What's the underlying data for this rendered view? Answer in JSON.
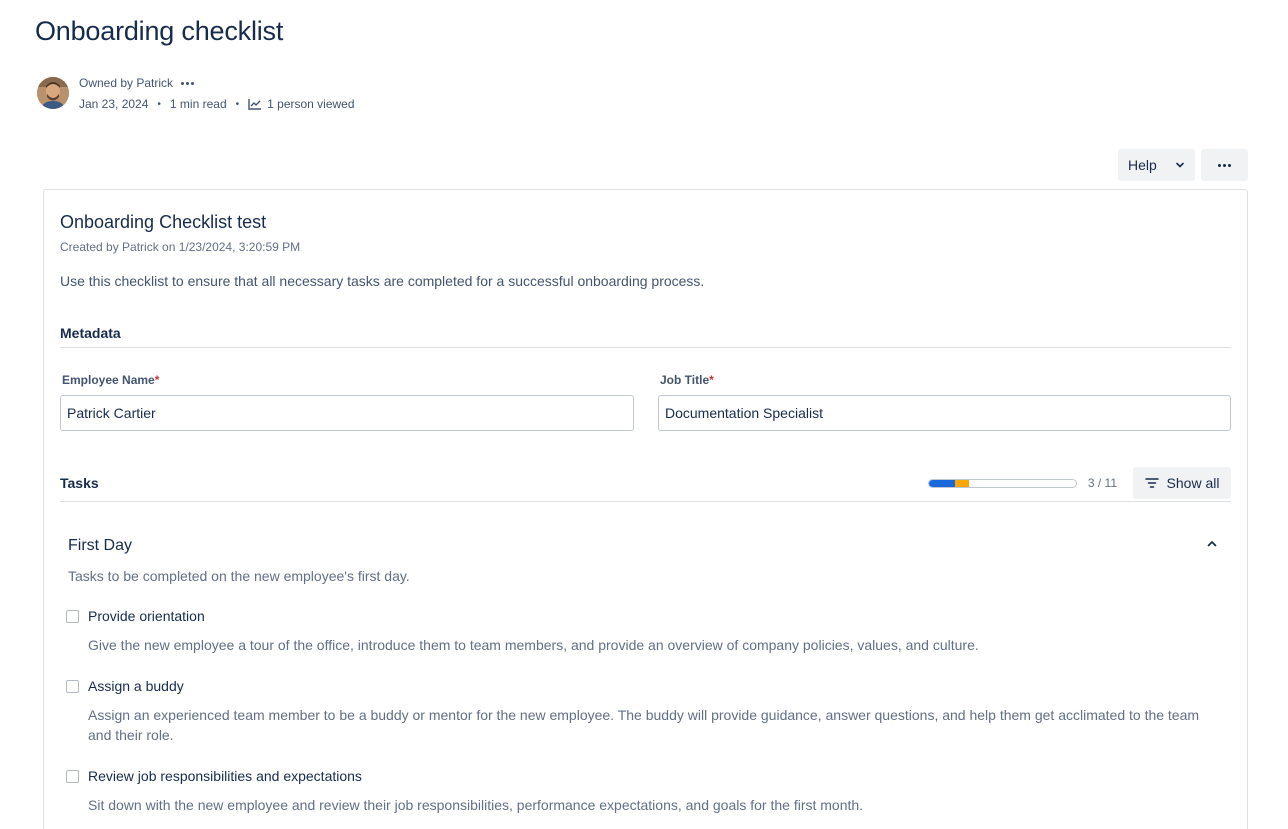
{
  "page": {
    "title": "Onboarding checklist"
  },
  "byline": {
    "owner": "Owned by Patrick",
    "date": "Jan 23, 2024",
    "read_time": "1 min read",
    "views": "1 person viewed"
  },
  "toolbar": {
    "help_label": "Help"
  },
  "checklist": {
    "title": "Onboarding Checklist test",
    "created": "Created by Patrick on 1/23/2024, 3:20:59 PM",
    "description": "Use this checklist to ensure that all necessary tasks are completed for a successful onboarding process."
  },
  "metadata": {
    "heading": "Metadata",
    "fields": [
      {
        "label": "Employee Name",
        "required_mark": "*",
        "value": "Patrick Cartier"
      },
      {
        "label": "Job Title",
        "required_mark": "*",
        "value": "Documentation Specialist"
      }
    ]
  },
  "tasks": {
    "heading": "Tasks",
    "progress_text": "3 / 11",
    "progress_done_fraction": 0.18,
    "progress_partial_fraction": 0.09,
    "show_all_label": "Show all",
    "colors": {
      "done": "#1868db",
      "partial": "#fca700"
    }
  },
  "group": {
    "title": "First Day",
    "description": "Tasks to be completed on the new employee's first day.",
    "items": [
      {
        "name": "Provide orientation",
        "description": "Give the new employee a tour of the office, introduce them to team members, and provide an overview of company policies, values, and culture."
      },
      {
        "name": "Assign a buddy",
        "description": "Assign an experienced team member to be a buddy or mentor for the new employee. The buddy will provide guidance, answer questions, and help them get acclimated to the team and their role."
      },
      {
        "name": "Review job responsibilities and expectations",
        "description": "Sit down with the new employee and review their job responsibilities, performance expectations, and goals for the first month."
      }
    ]
  }
}
